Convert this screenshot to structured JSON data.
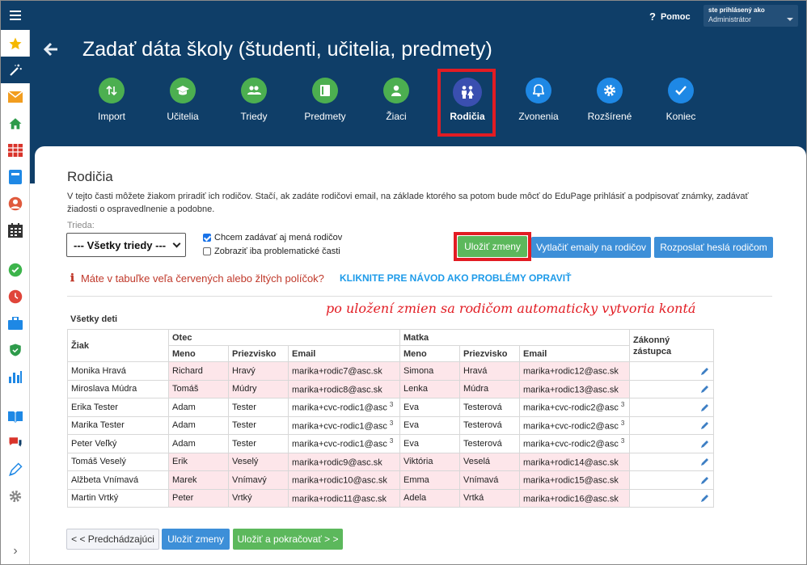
{
  "topbar": {
    "help": "Pomoc",
    "user_name": "ste prihlásený ako",
    "user_role": "Administrátor"
  },
  "sidebar": {
    "icons": [
      "star-icon",
      "wand-icon",
      "mail-icon",
      "home-icon",
      "calendar-grid-icon",
      "book-icon",
      "user-icon",
      "timetable-icon",
      "check-icon",
      "clock-icon",
      "briefcase-icon",
      "shield-icon",
      "chart-icon",
      "open-book-icon",
      "chat-icon",
      "pen-icon",
      "gear-icon"
    ],
    "expand": "›"
  },
  "page": {
    "title": "Zadať dáta školy (študenti, učitelia, predmety)"
  },
  "steps": [
    {
      "label": "Import",
      "icon": "import-icon"
    },
    {
      "label": "Učitelia",
      "icon": "graduation-cap-icon"
    },
    {
      "label": "Triedy",
      "icon": "group-icon"
    },
    {
      "label": "Predmety",
      "icon": "book-icon"
    },
    {
      "label": "Žiaci",
      "icon": "student-icon"
    },
    {
      "label": "Rodičia",
      "icon": "parents-icon"
    },
    {
      "label": "Zvonenia",
      "icon": "bell-icon"
    },
    {
      "label": "Rozšírené",
      "icon": "gear-icon"
    },
    {
      "label": "Koniec",
      "icon": "check-icon"
    }
  ],
  "section": {
    "title": "Rodičia",
    "description": "V tejto časti môžete žiakom priradiť ich rodičov. Stačí, ak zadáte rodičovi email, na základe ktorého sa potom bude môcť do EduPage prihlásiť a podpisovať známky, zadávať žiadosti o ospravedlnenie a podobne."
  },
  "filters": {
    "trieda_label": "Trieda:",
    "trieda_value": "--- Všetky triedy ---",
    "cb1": "Chcem zadávať aj mená rodičov",
    "cb1_checked": true,
    "cb2": "Zobraziť iba problematické časti",
    "cb2_checked": false
  },
  "actions": {
    "save": "Uložiť zmeny",
    "print_emails": "Vytlačiť emaily na rodičov",
    "send_passwords": "Rozposlať heslá rodičom"
  },
  "warning": {
    "icon": "ℹ",
    "text": "Máte v tabuľke veľa červených alebo žltých políčok?",
    "link": "KLIKNITE PRE NÁVOD AKO PROBLÉMY OPRAVIŤ"
  },
  "annotation": "po uložení zmien sa rodičom automaticky vytvoria kontá",
  "table": {
    "title": "Všetky deti",
    "headers": {
      "student": "Žiak",
      "father": "Otec",
      "mother": "Matka",
      "guardian": "Zákonný zástupca",
      "first": "Meno",
      "last": "Priezvisko",
      "email": "Email"
    },
    "rows": [
      {
        "student": "Monika Hravá",
        "f_first": "Richard",
        "f_last": "Hravý",
        "f_email": "marika+rodic7@asc.sk",
        "f_sup": "",
        "m_first": "Simona",
        "m_last": "Hravá",
        "m_email": "marika+rodic12@asc.sk",
        "m_sup": "",
        "pink": true
      },
      {
        "student": "Miroslava Múdra",
        "f_first": "Tomáš",
        "f_last": "Múdry",
        "f_email": "marika+rodic8@asc.sk",
        "f_sup": "",
        "m_first": "Lenka",
        "m_last": "Múdra",
        "m_email": "marika+rodic13@asc.sk",
        "m_sup": "",
        "pink": true
      },
      {
        "student": "Erika Tester",
        "f_first": "Adam",
        "f_last": "Tester",
        "f_email": "marika+cvc-rodic1@asc",
        "f_sup": "3",
        "m_first": "Eva",
        "m_last": "Testerová",
        "m_email": "marika+cvc-rodic2@asc",
        "m_sup": "3",
        "pink": false
      },
      {
        "student": "Marika Tester",
        "f_first": "Adam",
        "f_last": "Tester",
        "f_email": "marika+cvc-rodic1@asc",
        "f_sup": "3",
        "m_first": "Eva",
        "m_last": "Testerová",
        "m_email": "marika+cvc-rodic2@asc",
        "m_sup": "3",
        "pink": false
      },
      {
        "student": "Peter Veľký",
        "f_first": "Adam",
        "f_last": "Tester",
        "f_email": "marika+cvc-rodic1@asc",
        "f_sup": "3",
        "m_first": "Eva",
        "m_last": "Testerová",
        "m_email": "marika+cvc-rodic2@asc",
        "m_sup": "3",
        "pink": false
      },
      {
        "student": "Tomáš Veselý",
        "f_first": "Erik",
        "f_last": "Veselý",
        "f_email": "marika+rodic9@asc.sk",
        "f_sup": "",
        "m_first": "Viktória",
        "m_last": "Veselá",
        "m_email": "marika+rodic14@asc.sk",
        "m_sup": "",
        "pink": true
      },
      {
        "student": "Alžbeta Vnímavá",
        "f_first": "Marek",
        "f_last": "Vnímavý",
        "f_email": "marika+rodic10@asc.sk",
        "f_sup": "",
        "m_first": "Emma",
        "m_last": "Vnímavá",
        "m_email": "marika+rodic15@asc.sk",
        "m_sup": "",
        "pink": true
      },
      {
        "student": "Martin Vrtký",
        "f_first": "Peter",
        "f_last": "Vrtký",
        "f_email": "marika+rodic11@asc.sk",
        "f_sup": "",
        "m_first": "Adela",
        "m_last": "Vrtká",
        "m_email": "marika+rodic16@asc.sk",
        "m_sup": "",
        "pink": true
      }
    ]
  },
  "footer": {
    "prev": "< < Predchádzajúci",
    "save": "Uložiť zmeny",
    "save_continue": "Uložiť a pokračovať > >"
  },
  "colors": {
    "header": "#0f3e68",
    "step_green": "#4caf50",
    "step_blue": "#1e88e5",
    "step_active": "#3a4fb0",
    "button_blue": "#3d8fd8",
    "button_green": "#5cb85c",
    "highlight_red": "#e21c23",
    "pink_cell": "#fde6ea"
  }
}
